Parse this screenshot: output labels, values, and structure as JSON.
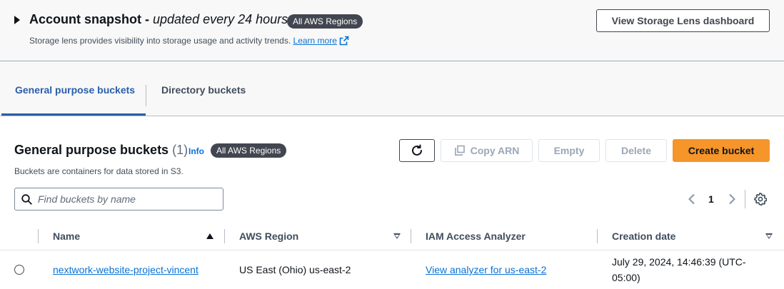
{
  "snapshot": {
    "title": "Account snapshot - ",
    "subtitle": "updated every 24 hours",
    "badge": "All AWS Regions",
    "description": "Storage lens provides visibility into storage usage and activity trends. ",
    "learn_more": "Learn more",
    "dashboard_button": "View Storage Lens dashboard"
  },
  "tabs": [
    {
      "label": "General purpose buckets",
      "active": true
    },
    {
      "label": "Directory buckets",
      "active": false
    }
  ],
  "section": {
    "title": "General purpose buckets",
    "count": "(1)",
    "info": "Info",
    "badge": "All AWS Regions",
    "description": "Buckets are containers for data stored in S3."
  },
  "toolbar": {
    "copy_arn": "Copy ARN",
    "empty": "Empty",
    "delete": "Delete",
    "create": "Create bucket"
  },
  "search": {
    "placeholder": "Find buckets by name",
    "value": ""
  },
  "pagination": {
    "current_page": "1"
  },
  "table": {
    "columns": [
      {
        "label": "Name",
        "sort": "ascending"
      },
      {
        "label": "AWS Region",
        "sort": "none"
      },
      {
        "label": "IAM Access Analyzer",
        "sort": ""
      },
      {
        "label": "Creation date",
        "sort": "none"
      }
    ],
    "rows": [
      {
        "name": "nextwork-website-project-vincent",
        "region": "US East (Ohio) us-east-2",
        "analyzer": "View analyzer for us-east-2",
        "created_line1": "July 29, 2024, 14:46:39 (UTC-",
        "created_line2": "05:00)"
      }
    ]
  },
  "colors": {
    "primary": "#f5952a",
    "link": "#0972d3",
    "tab_active": "#295eab",
    "badge_bg": "#424650"
  },
  "icons": [
    "caret-right-icon",
    "external-link-icon",
    "refresh-icon",
    "copy-icon",
    "search-icon",
    "chevron-left-icon",
    "chevron-right-icon",
    "settings-icon",
    "sort-ascending-icon",
    "sort-descending-icon"
  ]
}
